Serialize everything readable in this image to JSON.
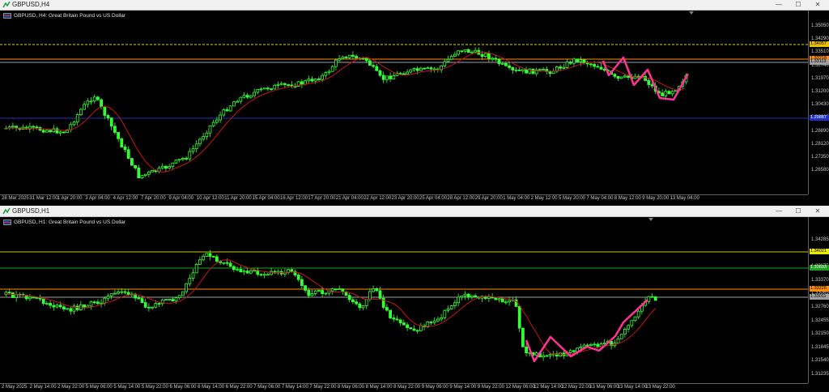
{
  "windows": [
    {
      "title": "GBPUSD,H4",
      "chart_label": "GBPUSD, H4:  Great Britain Pound vs US Dollar",
      "controls": {
        "minimize": "—",
        "maximize": "☐",
        "close": "✕"
      },
      "y_ticks": [
        "1.35050",
        "1.34290",
        "1.33510",
        "1.32740",
        "1.31970",
        "1.31200",
        "1.30430",
        "1.29660",
        "1.28890",
        "1.28120",
        "1.27350",
        "1.26580"
      ],
      "price_tags": [
        {
          "value": "1.34057",
          "bg": "#e8c000"
        },
        {
          "value": "1.33218",
          "bg": "#ff8c00"
        },
        {
          "value": "1.33113",
          "bg": "#a0a0a0"
        },
        {
          "value": "1.29887",
          "bg": "#2030c0"
        }
      ],
      "x_ticks": [
        "28 Mar 2025",
        "31 Mar 12:00",
        "1 Apr 20:00",
        "3 Apr 04:00",
        "4 Apr 12:00",
        "7 Apr 20:00",
        "9 Apr 04:00",
        "10 Apr 12:00",
        "11 Apr 20:00",
        "15 Apr 04:00",
        "16 Apr 12:00",
        "17 Apr 20:00",
        "21 Apr 04:00",
        "22 Apr 12:00",
        "23 Apr 20:00",
        "25 Apr 04:00",
        "28 Apr 12:00",
        "29 Apr 20:00",
        "1 May 04:00",
        "2 May 12:00",
        "5 May 20:00",
        "7 May 04:00",
        "8 May 12:00",
        "9 May 20:00",
        "13 May 04:00"
      ],
      "colors": {
        "bull": "#32ff32",
        "bear": "#32ff32",
        "ma": "#c81414",
        "zigzag": "#ff3296"
      }
    },
    {
      "title": "GBPUSD,H1",
      "chart_label": "GBPUSD, H1:  Great Britain Pound vs US Dollar",
      "controls": {
        "minimize": "—",
        "maximize": "☐",
        "close": "✕"
      },
      "y_ticks": [
        "1.34285",
        "1.33980",
        "1.33675",
        "1.33370",
        "1.33065",
        "1.32760",
        "1.32455",
        "1.32150",
        "1.31845",
        "1.31540",
        "1.31235"
      ],
      "price_tags": [
        {
          "value": "1.34021",
          "bg": "#e8e800"
        },
        {
          "value": "1.33693",
          "bg": "#20a020"
        },
        {
          "value": "1.33226",
          "bg": "#ff8c00"
        },
        {
          "value": "1.33011",
          "bg": "#a0a0a0"
        }
      ],
      "x_ticks": [
        "2 May 2025",
        "2 May 14:00",
        "2 May 22:00",
        "5 May 06:00",
        "5 May 14:00",
        "5 May 22:00",
        "6 May 06:00",
        "6 May 14:00",
        "6 May 22:00",
        "7 May 06:00",
        "7 May 14:00",
        "7 May 22:00",
        "8 May 06:00",
        "8 May 14:00",
        "8 May 22:00",
        "9 May 06:00",
        "9 May 14:00",
        "9 May 22:00",
        "12 May 06:00",
        "12 May 14:00",
        "12 May 22:00",
        "13 May 06:00",
        "13 May 14:00",
        "13 May 22:00"
      ],
      "colors": {
        "bull": "#32ff32",
        "bear": "#32ff32",
        "ma": "#c81414",
        "zigzag": "#ff3296"
      }
    }
  ]
}
